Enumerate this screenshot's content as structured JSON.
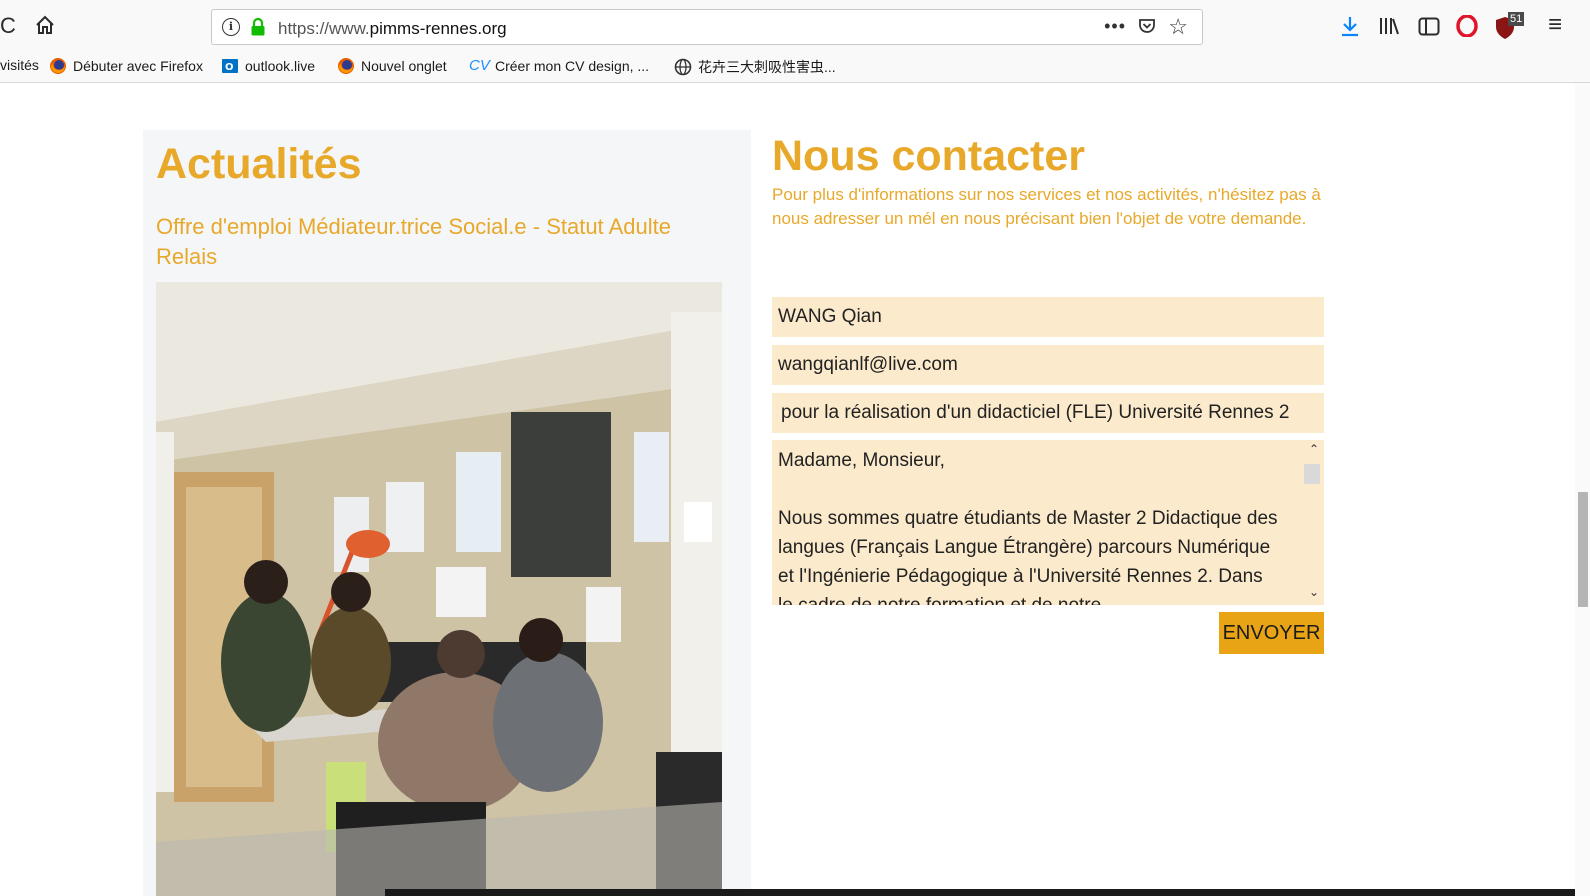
{
  "browser": {
    "url_prefix": "https://www.",
    "url_domain": "pimms-rennes.org",
    "more_label": "•••",
    "download_badge": "51",
    "bookmarks": [
      {
        "label": "visités",
        "icon": "none"
      },
      {
        "label": "Débuter avec Firefox",
        "icon": "firefox-icon"
      },
      {
        "label": "outlook.live",
        "icon": "outlook-icon"
      },
      {
        "label": "Nouvel onglet",
        "icon": "firefox-icon"
      },
      {
        "label": "Créer mon CV design, ...",
        "icon": "cv-icon"
      },
      {
        "label": "花卉三大刺吸性害虫...",
        "icon": "globe-icon"
      }
    ]
  },
  "news": {
    "title": "Actualités",
    "link": "Offre d'emploi Médiateur.trice Social.e - Statut Adulte Relais"
  },
  "contact": {
    "title": "Nous contacter",
    "text": "Pour plus d'informations sur nos services et nos activités, n'hésitez pas à nous adresser un mél en nous précisant bien l'objet de votre demande.",
    "name_value": "WANG Qian",
    "email_value": "wangqianlf@live.com",
    "subject_value": "pour la réalisation d'un didacticiel (FLE) Université Rennes 2",
    "message_value": "Madame, Monsieur,\n\nNous sommes quatre étudiants de Master 2 Didactique des langues (Français Langue Étrangère) parcours Numérique et l'Ingénierie Pédagogique à l'Université Rennes 2. Dans le cadre de notre formation et de notre",
    "send_label": "ENVOYER"
  },
  "colors": {
    "accent": "#e8a82a",
    "field_bg": "#fbeacb",
    "button": "#e8a415",
    "news_bg": "#f4f6f8"
  }
}
